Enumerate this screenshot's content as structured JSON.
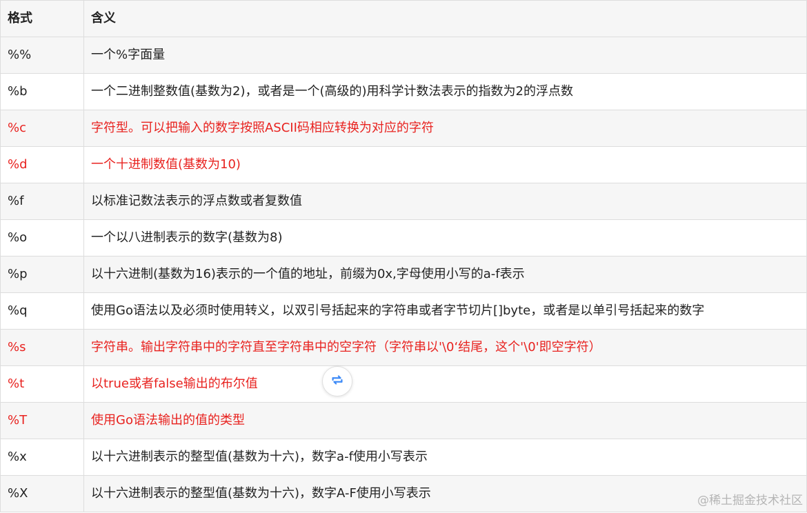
{
  "table": {
    "headers": [
      "格式",
      "含义"
    ],
    "rows": [
      {
        "fmt": "%%",
        "desc": "一个%字面量",
        "highlight": false
      },
      {
        "fmt": "%b",
        "desc": "一个二进制整数值(基数为2)，或者是一个(高级的)用科学计数法表示的指数为2的浮点数",
        "highlight": false
      },
      {
        "fmt": "%c",
        "desc": "字符型。可以把输入的数字按照ASCII码相应转换为对应的字符",
        "highlight": true
      },
      {
        "fmt": "%d",
        "desc": "一个十进制数值(基数为10)",
        "highlight": true
      },
      {
        "fmt": "%f",
        "desc": "以标准记数法表示的浮点数或者复数值",
        "highlight": false
      },
      {
        "fmt": "%o",
        "desc": "一个以八进制表示的数字(基数为8)",
        "highlight": false
      },
      {
        "fmt": "%p",
        "desc": "以十六进制(基数为16)表示的一个值的地址，前缀为0x,字母使用小写的a-f表示",
        "highlight": false
      },
      {
        "fmt": "%q",
        "desc": "使用Go语法以及必须时使用转义，以双引号括起来的字符串或者字节切片[]byte，或者是以单引号括起来的数字",
        "highlight": false
      },
      {
        "fmt": "%s",
        "desc": "字符串。输出字符串中的字符直至字符串中的空字符（字符串以'\\0‘结尾，这个'\\0'即空字符）",
        "highlight": true
      },
      {
        "fmt": "%t",
        "desc": "以true或者false输出的布尔值",
        "highlight": true
      },
      {
        "fmt": "%T",
        "desc": "使用Go语法输出的值的类型",
        "highlight": true
      },
      {
        "fmt": "%x",
        "desc": "以十六进制表示的整型值(基数为十六)，数字a-f使用小写表示",
        "highlight": false
      },
      {
        "fmt": "%X",
        "desc": "以十六进制表示的整型值(基数为十六)，数字A-F使用小写表示",
        "highlight": false
      }
    ]
  },
  "overlay": {
    "refresh_icon": "refresh-icon",
    "watermark": "@稀土掘金技术社区"
  },
  "colors": {
    "highlight_text": "#e8221f",
    "header_bg": "#f6f6f6",
    "striped_bg": "#f6f6f6",
    "border": "#dddddd",
    "icon_blue": "#3d8af7"
  }
}
